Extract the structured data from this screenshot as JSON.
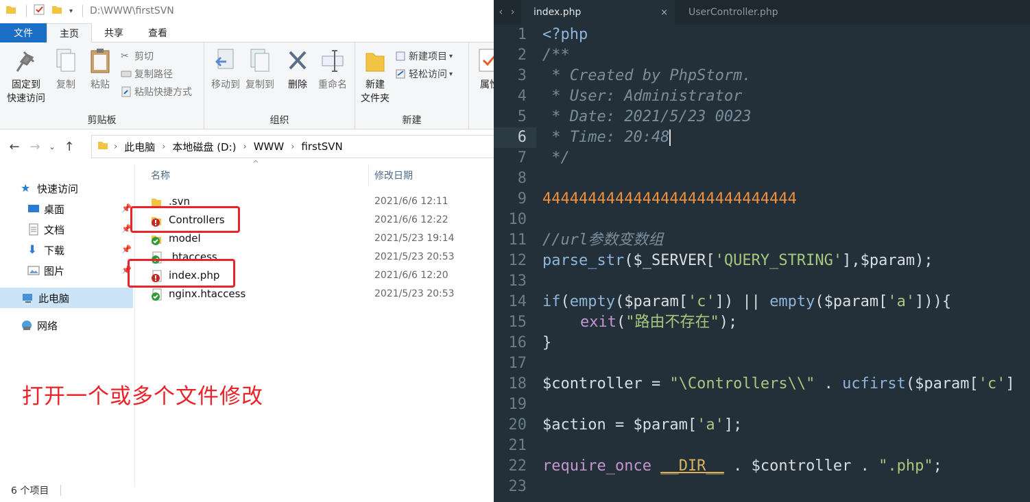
{
  "explorer": {
    "titlebar": {
      "path": "D:\\WWW\\firstSVN"
    },
    "tabs": [
      {
        "label": "文件"
      },
      {
        "label": "主页"
      },
      {
        "label": "共享"
      },
      {
        "label": "查看"
      }
    ],
    "ribbon": {
      "clipboard": {
        "group_label": "剪贴板",
        "pin_label_1": "固定到",
        "pin_label_2": "快速访问",
        "copy_label": "复制",
        "paste_label": "粘贴",
        "cut_label": "剪切",
        "copy_path_label": "复制路径",
        "paste_shortcut_label": "粘贴快捷方式"
      },
      "organize": {
        "group_label": "组织",
        "move_to_label": "移动到",
        "copy_to_label": "复制到",
        "delete_label": "删除",
        "rename_label": "重命名"
      },
      "new": {
        "group_label": "新建",
        "new_folder_label_1": "新建",
        "new_folder_label_2": "文件夹",
        "new_item_label": "新建项目",
        "easy_access_label": "轻松访问"
      },
      "open": {
        "properties_label": "属性"
      }
    },
    "address": {
      "crumbs": [
        "此电脑",
        "本地磁盘 (D:)",
        "WWW",
        "firstSVN"
      ]
    },
    "nav": {
      "quick_access": "快速访问",
      "desktop": "桌面",
      "documents": "文档",
      "downloads": "下载",
      "pictures": "图片",
      "this_pc": "此电脑",
      "network": "网络"
    },
    "columns": {
      "name": "名称",
      "date": "修改日期"
    },
    "files": [
      {
        "name": ".svn",
        "date": "2021/6/6 12:11",
        "status": "folder"
      },
      {
        "name": "Controllers",
        "date": "2021/6/6 12:22",
        "status": "modified"
      },
      {
        "name": "model",
        "date": "2021/5/23 19:14",
        "status": "normal"
      },
      {
        "name": ".htaccess",
        "date": "2021/5/23 20:53",
        "status": "normal"
      },
      {
        "name": "index.php",
        "date": "2021/6/6 12:20",
        "status": "modified"
      },
      {
        "name": "nginx.htaccess",
        "date": "2021/5/23 20:53",
        "status": "normal"
      }
    ],
    "annotation": "打开一个或多个文件修改",
    "status_bar": {
      "item_count": "6 个项目"
    }
  },
  "editor": {
    "tabs": [
      {
        "label": "index.php",
        "close": "×"
      },
      {
        "label": "UserController.php"
      }
    ],
    "current_line": 6,
    "line_numbers": [
      "1",
      "2",
      "3",
      "4",
      "5",
      "6",
      "7",
      "8",
      "9",
      "10",
      "11",
      "12",
      "13",
      "14",
      "15",
      "16",
      "17",
      "18",
      "19",
      "20",
      "21",
      "22",
      "23"
    ],
    "code": {
      "l1": "<?php",
      "l2": "/**",
      "l3": " * Created by PhpStorm.",
      "l4": " * User: Administrator",
      "l5": " * Date: 2021/5/23 0023",
      "l6": " * Time: 20:48",
      "l7": " */",
      "l9": "4444444444444444444444444444",
      "l11": "//url参数变数组",
      "l12_fn": "parse_str",
      "l12_a": "($_SERVER[",
      "l12_s": "'QUERY_STRING'",
      "l12_b": "],$param);",
      "l14_kw": "if",
      "l14_a": "(",
      "l14_fn1": "empty",
      "l14_b": "($param[",
      "l14_s1": "'c'",
      "l14_c": "]) || ",
      "l14_fn2": "empty",
      "l14_d": "($param[",
      "l14_s2": "'a'",
      "l14_e": "])){",
      "l15_kw": "exit",
      "l15_a": "(",
      "l15_s": "\"路由不存在\"",
      "l15_b": ");",
      "l16": "}",
      "l18_a": "$controller = ",
      "l18_s": "\"\\Controllers\\\\\"",
      "l18_b": " . ",
      "l18_fn": "ucfirst",
      "l18_c": "($param[",
      "l18_s2": "'c'",
      "l18_d": "]",
      "l20_a": "$action = $param[",
      "l20_s": "'a'",
      "l20_b": "];",
      "l22_kw": "require_once",
      "l22_const": "__DIR__",
      "l22_a": " . $controller . ",
      "l22_s": "\".php\"",
      "l22_b": ";"
    }
  },
  "colors": {
    "annotation_red": "#e8232a",
    "editor_bg": "#233039",
    "file_tab_blue": "#1a6fc4"
  }
}
